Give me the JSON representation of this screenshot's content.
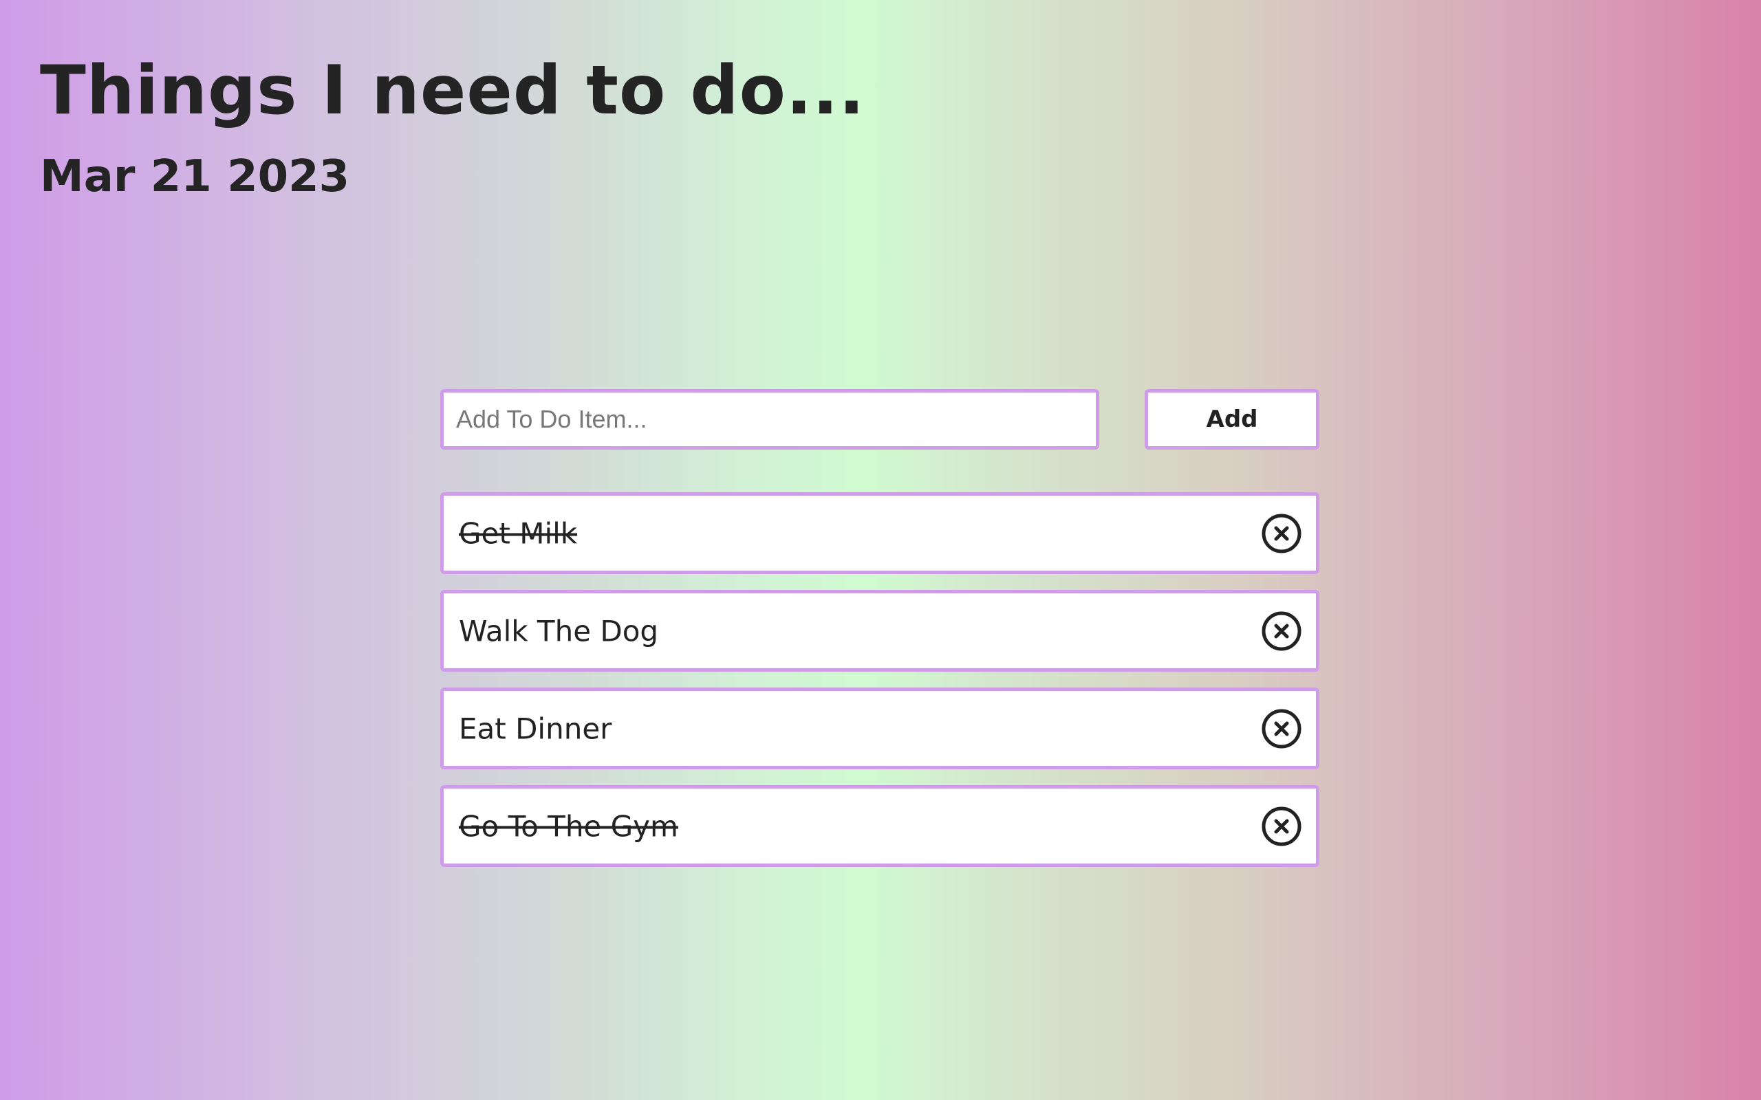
{
  "header": {
    "title": "Things I need to do...",
    "date": "Mar 21 2023"
  },
  "add_form": {
    "placeholder": "Add To Do Item...",
    "value": "",
    "button_label": "Add"
  },
  "todos": [
    {
      "text": "Get Milk",
      "completed": true,
      "remove_icon": "close-circle-icon"
    },
    {
      "text": "Walk The Dog",
      "completed": false,
      "remove_icon": "close-circle-icon"
    },
    {
      "text": "Eat Dinner",
      "completed": false,
      "remove_icon": "close-circle-icon"
    },
    {
      "text": "Go To The Gym",
      "completed": true,
      "remove_icon": "close-circle-icon"
    }
  ],
  "colors": {
    "border": "#cf9ce8",
    "text": "#222222",
    "gradient": [
      "#cf9ce8",
      "#d0fbd0",
      "#d882aa"
    ]
  }
}
